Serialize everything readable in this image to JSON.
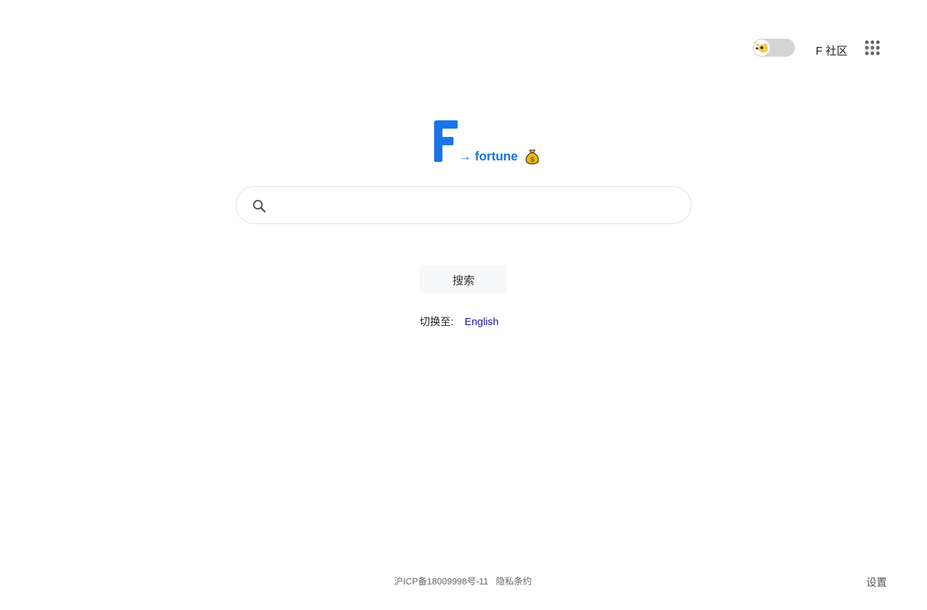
{
  "header": {
    "theme_toggle_state": "off",
    "community_label": "F 社区",
    "apps_icon": "apps-grid-icon"
  },
  "logo": {
    "letter": "F",
    "tagline": "→ fortune",
    "emoji": "money-bag-icon",
    "brand_color": "#1a73e8"
  },
  "search": {
    "value": "",
    "placeholder": "",
    "button_label": "搜索"
  },
  "language": {
    "label": "切换至:",
    "option": "English"
  },
  "footer": {
    "icp": "沪ICP备18009998号-11",
    "privacy": "隐私条约",
    "settings": "设置"
  }
}
